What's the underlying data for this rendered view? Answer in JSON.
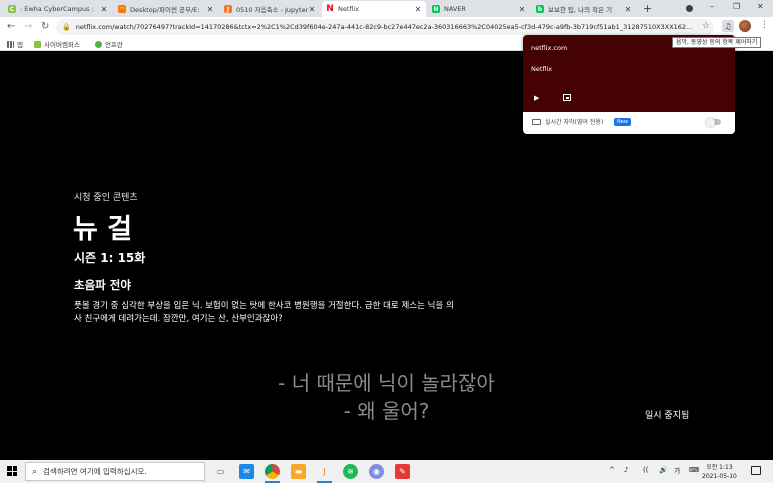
{
  "browser": {
    "tabs": [
      {
        "title": ": Ewha CyberCampus :",
        "favicon_color": "#8bc34a",
        "favicon_glyph": "C",
        "active": false
      },
      {
        "title": "Desktop/파이썬 공부/E:",
        "favicon_color": "#f57c00",
        "favicon_glyph": "◠",
        "active": false
      },
      {
        "title": "0510 자음축소 - Jupyter",
        "favicon_color": "#f37626",
        "favicon_glyph": "J",
        "active": false
      },
      {
        "title": "Netflix",
        "favicon_color": "#e50914",
        "favicon_glyph": "N",
        "active": true
      },
      {
        "title": "NAVER",
        "favicon_color": "#03c75a",
        "favicon_glyph": "N",
        "active": false
      },
      {
        "title": "보보한 팁, 나의 작은 기",
        "favicon_color": "#03c75a",
        "favicon_glyph": "b",
        "active": false
      }
    ],
    "new_tab_icon": "+",
    "window_controls": [
      "–",
      "❐",
      "✕"
    ],
    "url": "netflix.com/watch/70276497?trackId=14170286&tctx=2%2C1%2Cd39f604e-247a-441c-82c9-bc27e447ec2a-360316663%2C04025ea5-cf3d-479c-a9fb-3b719cf51ab1_31287510X3XX162...",
    "bookmarks": [
      {
        "label": "앱",
        "color": "#5f6368"
      },
      {
        "label": "사이버캠퍼스",
        "color": "#8bc34a"
      },
      {
        "label": "언프란",
        "color": "#4caf50"
      }
    ]
  },
  "media_popup": {
    "origin": "netflix.com",
    "title": "Netflix",
    "play_icon": "▶",
    "caption_label": "실시간 자막(영어 전용)",
    "badge": "New",
    "caption_enabled": false,
    "card_color": "#450203"
  },
  "tooltip": "음악, 동영상 등의 항목 제어하기",
  "player": {
    "now_watching": "시청 중인 콘텐츠",
    "show_title": "뉴 걸",
    "episode": "시즌 1: 15화",
    "episode_title": "초음파 전야",
    "synopsis": "풋볼 경기 중 심각한 부상을 입은 닉. 보험이 없는 탓에 한사코 병원행을 거절한다. 급한 대로 제스는 닉을 의사 친구에게 데려가는데. 잠깐만, 여기는 산, 산부인과잖아?",
    "subtitles": [
      "- 너 때문에 닉이 놀라잖아",
      "- 왜 울어?"
    ],
    "status": "일시 중지됨"
  },
  "taskbar": {
    "search_placeholder": "검색하려면 여기에 입력하십시오.",
    "apps": [
      {
        "name": "task-view",
        "color": "#7a7a7a",
        "glyph": "▭"
      },
      {
        "name": "mail",
        "color": "#1e88e5",
        "glyph": "✉"
      },
      {
        "name": "chrome",
        "color": "#db4437",
        "glyph": "●"
      },
      {
        "name": "file-explorer",
        "color": "#f9a825",
        "glyph": "▬"
      },
      {
        "name": "jupyter",
        "color": "#f37626",
        "glyph": "J"
      },
      {
        "name": "spotify",
        "color": "#1db954",
        "glyph": "≋"
      },
      {
        "name": "app-purple",
        "color": "#7e8ee8",
        "glyph": "◉"
      },
      {
        "name": "app-red",
        "color": "#e53935",
        "glyph": "✎"
      }
    ],
    "tray_text": [
      "^",
      "♪",
      "((",
      "🔊",
      "가",
      "⌨"
    ],
    "time": "오전 1:13",
    "date": "2021-05-10"
  }
}
